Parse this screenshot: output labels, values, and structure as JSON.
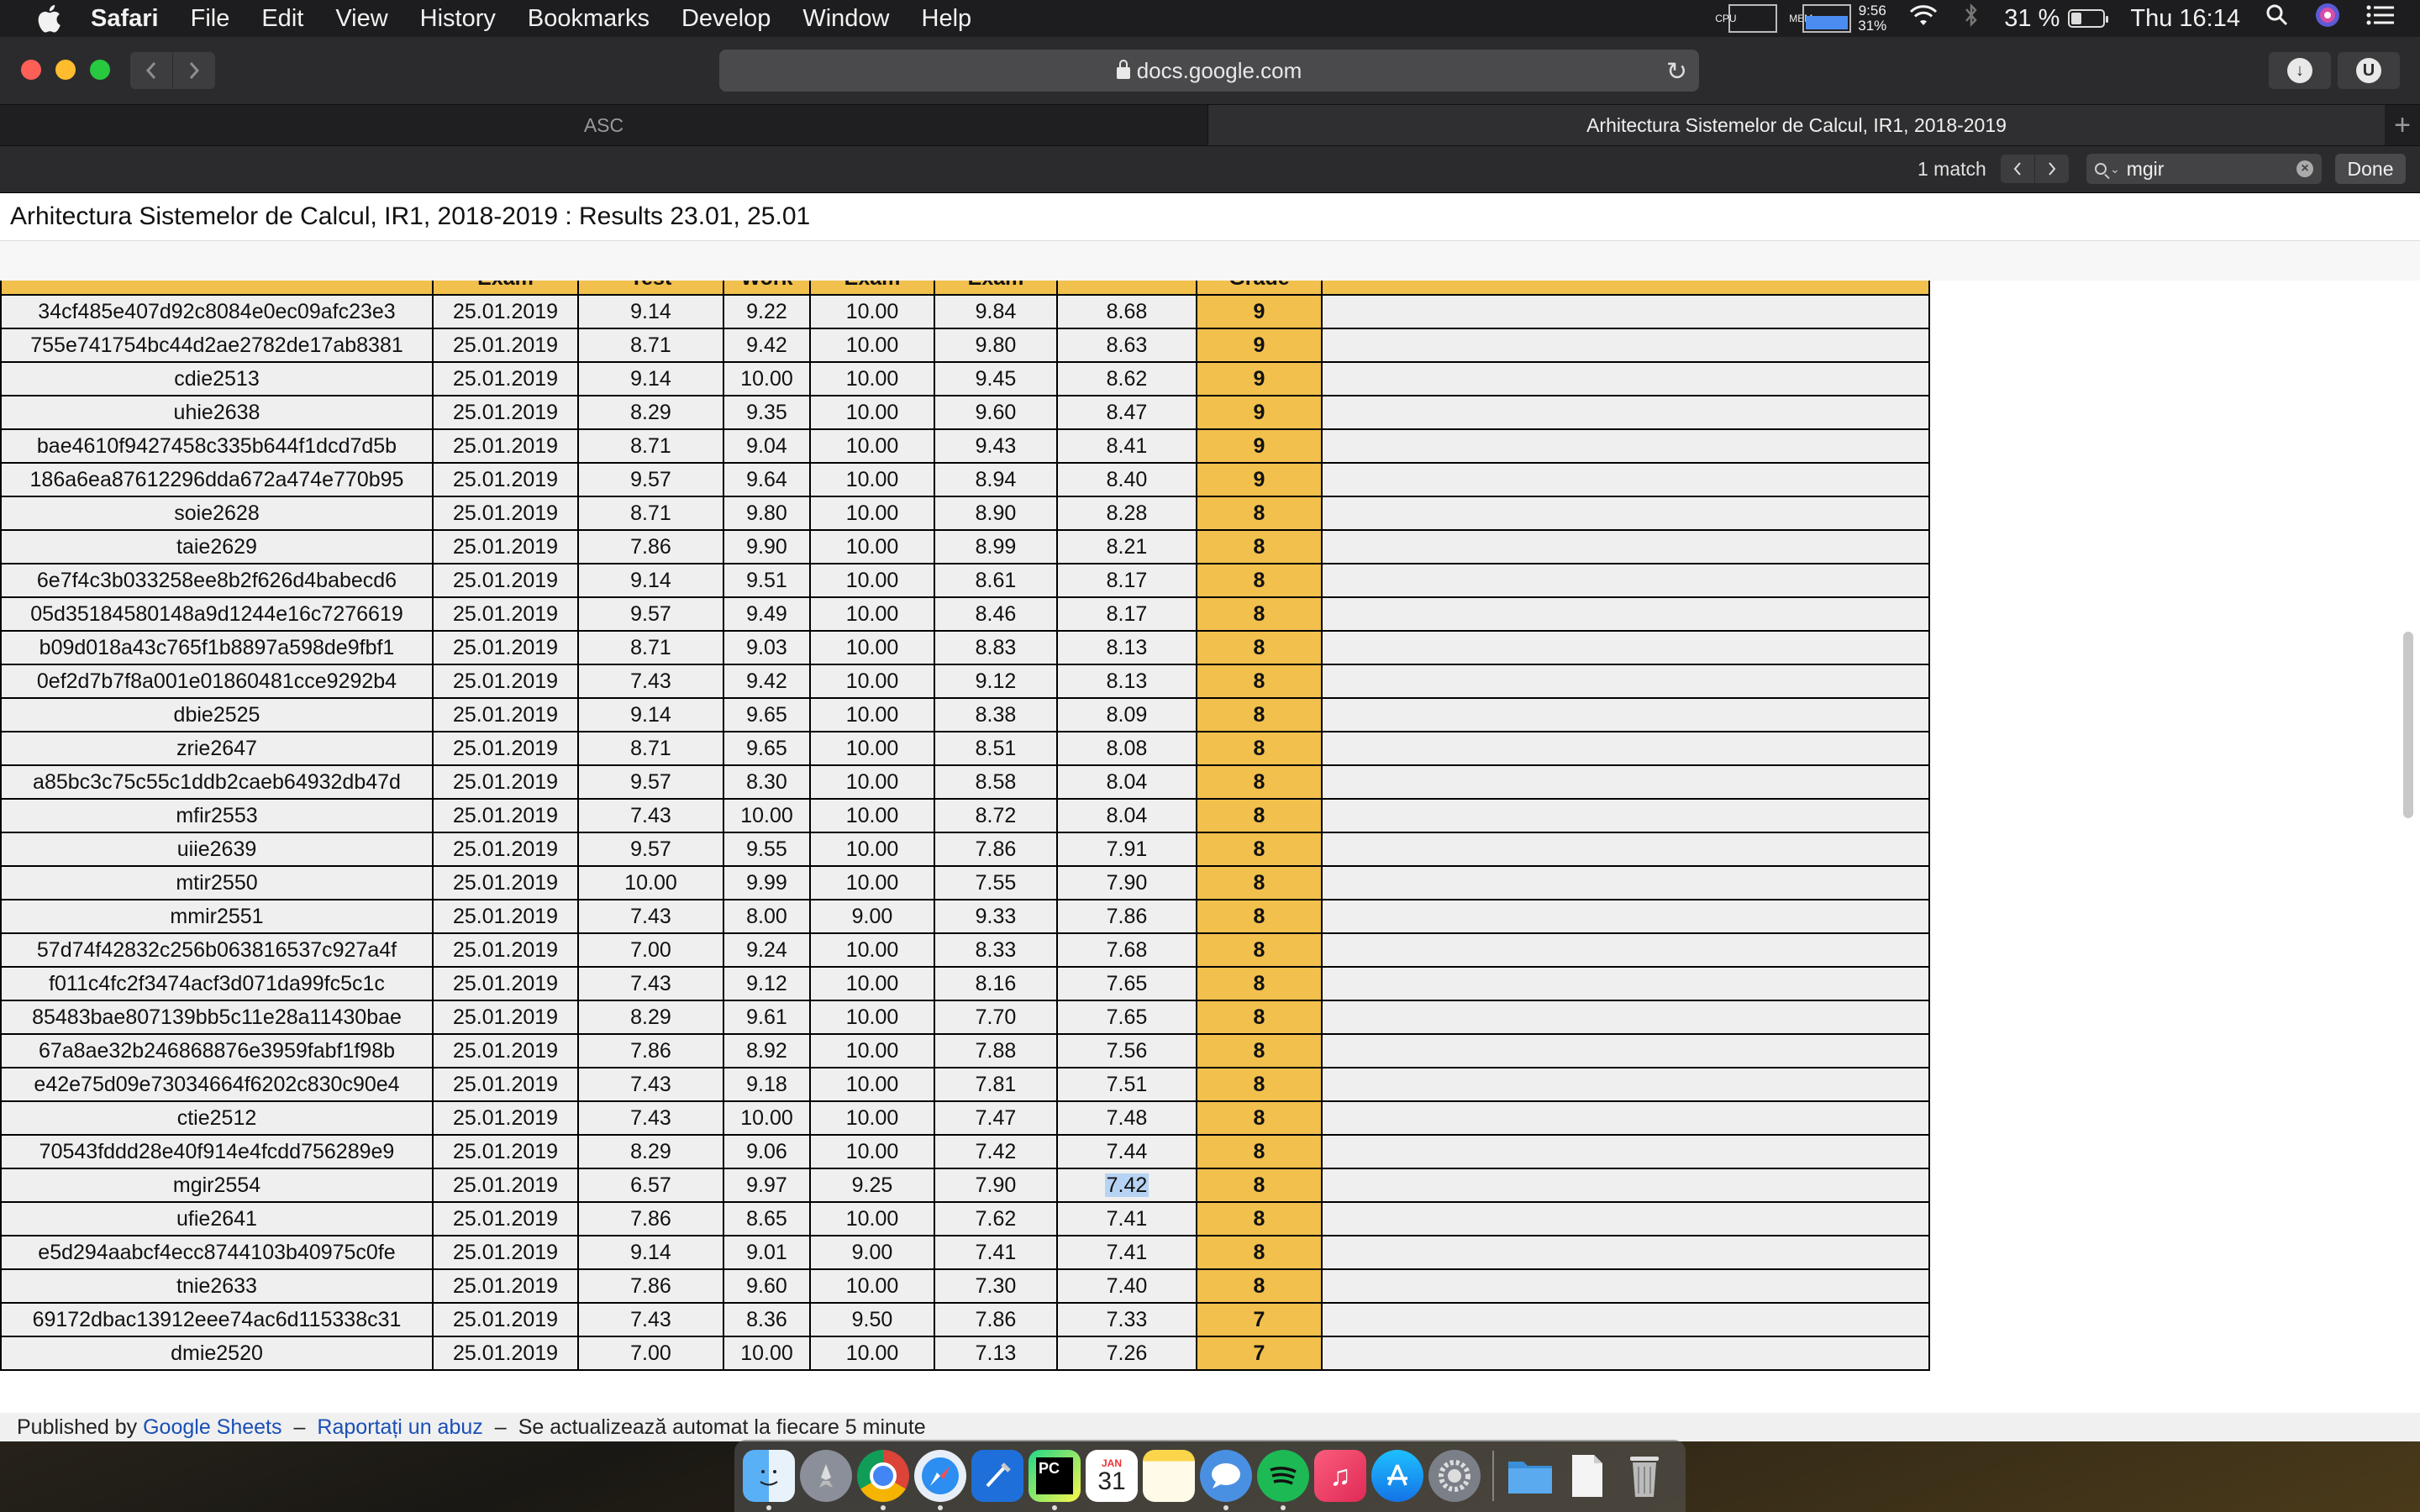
{
  "menubar": {
    "app_name": "Safari",
    "items": [
      "File",
      "Edit",
      "View",
      "History",
      "Bookmarks",
      "Develop",
      "Window",
      "Help"
    ],
    "cpu_label": "CPU",
    "mem_label": "MEM",
    "mem_time": "9:56",
    "mem_percent": "31%",
    "battery_percent": "31 %",
    "clock": "Thu 16:14"
  },
  "toolbar": {
    "url": "docs.google.com"
  },
  "tabs": [
    {
      "label": "ASC",
      "active": false
    },
    {
      "label": "Arhitectura Sistemelor de Calcul, IR1, 2018-2019",
      "active": true
    }
  ],
  "findbar": {
    "match_count": "1 match",
    "query": "mgir",
    "done_label": "Done"
  },
  "document": {
    "title": "Arhitectura Sistemelor de Calcul, IR1, 2018-2019 : Results 23.01, 25.01"
  },
  "table": {
    "headers": [
      "",
      "Exam",
      "Test",
      "Work",
      "Exam",
      "Exam",
      "",
      "Grade"
    ],
    "rows": [
      [
        "34cf485e407d92c8084e0ec09afc23e3",
        "25.01.2019",
        "9.14",
        "9.22",
        "10.00",
        "9.84",
        "8.68",
        "9"
      ],
      [
        "755e741754bc44d2ae2782de17ab8381",
        "25.01.2019",
        "8.71",
        "9.42",
        "10.00",
        "9.80",
        "8.63",
        "9"
      ],
      [
        "cdie2513",
        "25.01.2019",
        "9.14",
        "10.00",
        "10.00",
        "9.45",
        "8.62",
        "9"
      ],
      [
        "uhie2638",
        "25.01.2019",
        "8.29",
        "9.35",
        "10.00",
        "9.60",
        "8.47",
        "9"
      ],
      [
        "bae4610f9427458c335b644f1dcd7d5b",
        "25.01.2019",
        "8.71",
        "9.04",
        "10.00",
        "9.43",
        "8.41",
        "9"
      ],
      [
        "186a6ea87612296dda672a474e770b95",
        "25.01.2019",
        "9.57",
        "9.64",
        "10.00",
        "8.94",
        "8.40",
        "9"
      ],
      [
        "soie2628",
        "25.01.2019",
        "8.71",
        "9.80",
        "10.00",
        "8.90",
        "8.28",
        "8"
      ],
      [
        "taie2629",
        "25.01.2019",
        "7.86",
        "9.90",
        "10.00",
        "8.99",
        "8.21",
        "8"
      ],
      [
        "6e7f4c3b033258ee8b2f626d4babecd6",
        "25.01.2019",
        "9.14",
        "9.51",
        "10.00",
        "8.61",
        "8.17",
        "8"
      ],
      [
        "05d35184580148a9d1244e16c7276619",
        "25.01.2019",
        "9.57",
        "9.49",
        "10.00",
        "8.46",
        "8.17",
        "8"
      ],
      [
        "b09d018a43c765f1b8897a598de9fbf1",
        "25.01.2019",
        "8.71",
        "9.03",
        "10.00",
        "8.83",
        "8.13",
        "8"
      ],
      [
        "0ef2d7b7f8a001e01860481cce9292b4",
        "25.01.2019",
        "7.43",
        "9.42",
        "10.00",
        "9.12",
        "8.13",
        "8"
      ],
      [
        "dbie2525",
        "25.01.2019",
        "9.14",
        "9.65",
        "10.00",
        "8.38",
        "8.09",
        "8"
      ],
      [
        "zrie2647",
        "25.01.2019",
        "8.71",
        "9.65",
        "10.00",
        "8.51",
        "8.08",
        "8"
      ],
      [
        "a85bc3c75c55c1ddb2caeb64932db47d",
        "25.01.2019",
        "9.57",
        "8.30",
        "10.00",
        "8.58",
        "8.04",
        "8"
      ],
      [
        "mfir2553",
        "25.01.2019",
        "7.43",
        "10.00",
        "10.00",
        "8.72",
        "8.04",
        "8"
      ],
      [
        "uiie2639",
        "25.01.2019",
        "9.57",
        "9.55",
        "10.00",
        "7.86",
        "7.91",
        "8"
      ],
      [
        "mtir2550",
        "25.01.2019",
        "10.00",
        "9.99",
        "10.00",
        "7.55",
        "7.90",
        "8"
      ],
      [
        "mmir2551",
        "25.01.2019",
        "7.43",
        "8.00",
        "9.00",
        "9.33",
        "7.86",
        "8"
      ],
      [
        "57d74f42832c256b063816537c927a4f",
        "25.01.2019",
        "7.00",
        "9.24",
        "10.00",
        "8.33",
        "7.68",
        "8"
      ],
      [
        "f011c4fc2f3474acf3d071da99fc5c1c",
        "25.01.2019",
        "7.43",
        "9.12",
        "10.00",
        "8.16",
        "7.65",
        "8"
      ],
      [
        "85483bae807139bb5c11e28a11430bae",
        "25.01.2019",
        "8.29",
        "9.61",
        "10.00",
        "7.70",
        "7.65",
        "8"
      ],
      [
        "67a8ae32b246868876e3959fabf1f98b",
        "25.01.2019",
        "7.86",
        "8.92",
        "10.00",
        "7.88",
        "7.56",
        "8"
      ],
      [
        "e42e75d09e73034664f6202c830c90e4",
        "25.01.2019",
        "7.43",
        "9.18",
        "10.00",
        "7.81",
        "7.51",
        "8"
      ],
      [
        "ctie2512",
        "25.01.2019",
        "7.43",
        "10.00",
        "10.00",
        "7.47",
        "7.48",
        "8"
      ],
      [
        "70543fddd28e40f914e4fcdd756289e9",
        "25.01.2019",
        "8.29",
        "9.06",
        "10.00",
        "7.42",
        "7.44",
        "8"
      ],
      [
        "mgir2554",
        "25.01.2019",
        "6.57",
        "9.97",
        "9.25",
        "7.90",
        "7.42",
        "8"
      ],
      [
        "ufie2641",
        "25.01.2019",
        "7.86",
        "8.65",
        "10.00",
        "7.62",
        "7.41",
        "8"
      ],
      [
        "e5d294aabcf4ecc8744103b40975c0fe",
        "25.01.2019",
        "9.14",
        "9.01",
        "9.00",
        "7.41",
        "7.41",
        "8"
      ],
      [
        "tnie2633",
        "25.01.2019",
        "7.86",
        "9.60",
        "10.00",
        "7.30",
        "7.40",
        "8"
      ],
      [
        "69172dbac13912eee74ac6d115338c31",
        "25.01.2019",
        "7.43",
        "8.36",
        "9.50",
        "7.86",
        "7.33",
        "7"
      ],
      [
        "dmie2520",
        "25.01.2019",
        "7.00",
        "10.00",
        "10.00",
        "7.13",
        "7.26",
        "7"
      ]
    ],
    "highlight": {
      "row": 26,
      "col": 6
    }
  },
  "footer": {
    "published_by": "Published by",
    "sheets_link": "Google Sheets",
    "dash1": "–",
    "abuse_link": "Raportați un abuz",
    "dash2": "–",
    "auto_update": "Se actualizează automat la fiecare 5 minute"
  },
  "dock": {
    "calendar_month": "JAN",
    "calendar_day": "31",
    "apps": [
      "Finder",
      "Launchpad",
      "Chrome",
      "Safari",
      "Xcode",
      "PyCharm",
      "Calendar",
      "Notes",
      "Messages",
      "Spotify",
      "Music",
      "App Store",
      "System Preferences",
      "Folder",
      "Documents",
      "Trash"
    ]
  },
  "colors": {
    "grade_yellow": "#f1c04d",
    "find_highlight": "#b6d3f3",
    "link_blue": "#1a4fb5"
  }
}
